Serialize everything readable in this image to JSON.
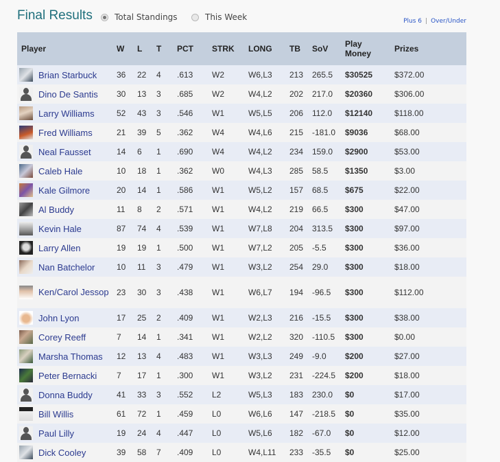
{
  "header": {
    "title": "Final Results",
    "view_options": [
      {
        "label": "Total Standings",
        "selected": true
      },
      {
        "label": "This Week",
        "selected": false
      }
    ],
    "links": [
      "Plus 6",
      "Over/Under"
    ],
    "separator": "|"
  },
  "table": {
    "columns": {
      "player": "Player",
      "w": "W",
      "l": "L",
      "t": "T",
      "pct": "PCT",
      "strk": "STRK",
      "long": "LONG",
      "tb": "TB",
      "sov": "SoV",
      "play_money_1": "Play",
      "play_money_2": "Money",
      "prizes": "Prizes"
    },
    "rows": [
      {
        "name": "Brian Starbuck",
        "avatar": "photo",
        "w": "36",
        "l": "22",
        "t": "4",
        "pct": ".613",
        "strk": "W2",
        "long": "W6,L3",
        "tb": "213",
        "sov": "265.5",
        "play_money": "$30525",
        "prizes": "$372.00"
      },
      {
        "name": "Dino De Santis",
        "avatar": "silhouette",
        "w": "30",
        "l": "13",
        "t": "3",
        "pct": ".685",
        "strk": "W2",
        "long": "W4,L2",
        "tb": "202",
        "sov": "217.0",
        "play_money": "$20360",
        "prizes": "$306.00"
      },
      {
        "name": "Larry Williams",
        "avatar": "photo",
        "w": "52",
        "l": "43",
        "t": "3",
        "pct": ".546",
        "strk": "W1",
        "long": "W5,L5",
        "tb": "206",
        "sov": "112.0",
        "play_money": "$12140",
        "prizes": "$118.00"
      },
      {
        "name": "Fred Williams",
        "avatar": "photo",
        "w": "21",
        "l": "39",
        "t": "5",
        "pct": ".362",
        "strk": "W4",
        "long": "W4,L6",
        "tb": "215",
        "sov": "-181.0",
        "play_money": "$9036",
        "prizes": "$68.00"
      },
      {
        "name": "Neal Fausset",
        "avatar": "silhouette",
        "w": "14",
        "l": "6",
        "t": "1",
        "pct": ".690",
        "strk": "W4",
        "long": "W4,L2",
        "tb": "234",
        "sov": "159.0",
        "play_money": "$2900",
        "prizes": "$53.00"
      },
      {
        "name": "Caleb Hale",
        "avatar": "photo",
        "w": "10",
        "l": "18",
        "t": "1",
        "pct": ".362",
        "strk": "W0",
        "long": "W4,L3",
        "tb": "285",
        "sov": "58.5",
        "play_money": "$1350",
        "prizes": "$3.00"
      },
      {
        "name": "Kale Gilmore",
        "avatar": "photo",
        "w": "20",
        "l": "14",
        "t": "1",
        "pct": ".586",
        "strk": "W1",
        "long": "W5,L2",
        "tb": "157",
        "sov": "68.5",
        "play_money": "$675",
        "prizes": "$22.00"
      },
      {
        "name": "Al Buddy",
        "avatar": "photo",
        "w": "11",
        "l": "8",
        "t": "2",
        "pct": ".571",
        "strk": "W1",
        "long": "W4,L2",
        "tb": "219",
        "sov": "66.5",
        "play_money": "$300",
        "prizes": "$47.00"
      },
      {
        "name": "Kevin Hale",
        "avatar": "photo",
        "w": "87",
        "l": "74",
        "t": "4",
        "pct": ".539",
        "strk": "W1",
        "long": "W7,L8",
        "tb": "204",
        "sov": "313.5",
        "play_money": "$300",
        "prizes": "$97.00"
      },
      {
        "name": "Larry Allen",
        "avatar": "photo",
        "w": "19",
        "l": "19",
        "t": "1",
        "pct": ".500",
        "strk": "W1",
        "long": "W7,L2",
        "tb": "205",
        "sov": "-5.5",
        "play_money": "$300",
        "prizes": "$36.00"
      },
      {
        "name": "Nan Batchelor",
        "avatar": "photo",
        "w": "10",
        "l": "11",
        "t": "3",
        "pct": ".479",
        "strk": "W1",
        "long": "W3,L2",
        "tb": "254",
        "sov": "29.0",
        "play_money": "$300",
        "prizes": "$18.00"
      },
      {
        "name": "Ken/Carol Jessop",
        "avatar": "photo",
        "w": "23",
        "l": "30",
        "t": "3",
        "pct": ".438",
        "strk": "W1",
        "long": "W6,L7",
        "tb": "194",
        "sov": "-96.5",
        "play_money": "$300",
        "prizes": "$112.00"
      },
      {
        "name": "John Lyon",
        "avatar": "photo",
        "w": "17",
        "l": "25",
        "t": "2",
        "pct": ".409",
        "strk": "W1",
        "long": "W2,L3",
        "tb": "216",
        "sov": "-15.5",
        "play_money": "$300",
        "prizes": "$38.00"
      },
      {
        "name": "Corey Reeff",
        "avatar": "photo",
        "w": "7",
        "l": "14",
        "t": "1",
        "pct": ".341",
        "strk": "W1",
        "long": "W2,L2",
        "tb": "320",
        "sov": "-110.5",
        "play_money": "$300",
        "prizes": "$0.00"
      },
      {
        "name": "Marsha Thomas",
        "avatar": "photo",
        "w": "12",
        "l": "13",
        "t": "4",
        "pct": ".483",
        "strk": "W1",
        "long": "W3,L3",
        "tb": "249",
        "sov": "-9.0",
        "play_money": "$200",
        "prizes": "$27.00"
      },
      {
        "name": "Peter Bernacki",
        "avatar": "photo",
        "w": "7",
        "l": "17",
        "t": "1",
        "pct": ".300",
        "strk": "W1",
        "long": "W3,L2",
        "tb": "231",
        "sov": "-224.5",
        "play_money": "$200",
        "prizes": "$18.00"
      },
      {
        "name": "Donna Buddy",
        "avatar": "silhouette",
        "w": "41",
        "l": "33",
        "t": "3",
        "pct": ".552",
        "strk": "L2",
        "long": "W5,L3",
        "tb": "183",
        "sov": "230.0",
        "play_money": "$0",
        "prizes": "$17.00"
      },
      {
        "name": "Bill Willis",
        "avatar": "photo",
        "w": "61",
        "l": "72",
        "t": "1",
        "pct": ".459",
        "strk": "L0",
        "long": "W6,L6",
        "tb": "147",
        "sov": "-218.5",
        "play_money": "$0",
        "prizes": "$35.00"
      },
      {
        "name": "Paul Lilly",
        "avatar": "silhouette",
        "w": "19",
        "l": "24",
        "t": "4",
        "pct": ".447",
        "strk": "L0",
        "long": "W5,L6",
        "tb": "182",
        "sov": "-67.0",
        "play_money": "$0",
        "prizes": "$12.00"
      },
      {
        "name": "Dick Cooley",
        "avatar": "photo",
        "w": "39",
        "l": "58",
        "t": "7",
        "pct": ".409",
        "strk": "L0",
        "long": "W4,L11",
        "tb": "233",
        "sov": "-35.5",
        "play_money": "$0",
        "prizes": "$25.00"
      }
    ]
  }
}
